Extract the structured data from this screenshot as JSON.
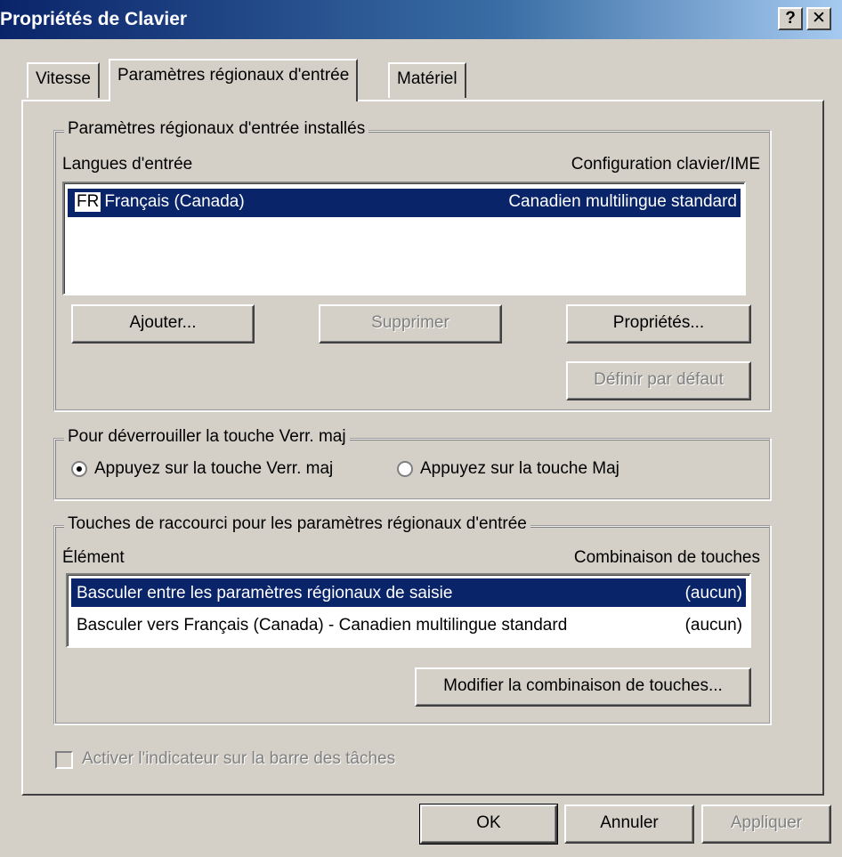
{
  "window": {
    "title": "Propriétés de Clavier",
    "help_label": "?",
    "close_label": "✕"
  },
  "tabs": [
    {
      "label": "Vitesse",
      "selected": false
    },
    {
      "label": "Paramètres régionaux d'entrée",
      "selected": true
    },
    {
      "label": "Matériel",
      "selected": false
    }
  ],
  "installed": {
    "group_label": "Paramètres régionaux d'entrée installés",
    "col_lang": "Langues d'entrée",
    "col_config": "Configuration clavier/IME",
    "rows": [
      {
        "badge": "FR",
        "lang": "Français (Canada)",
        "config": "Canadien multilingue standard",
        "selected": true
      }
    ],
    "buttons": {
      "add": "Ajouter...",
      "remove": "Supprimer",
      "properties": "Propriétés...",
      "set_default": "Définir par défaut"
    }
  },
  "capslock": {
    "group_label": "Pour déverrouiller la touche Verr. maj",
    "option_capslock": "Appuyez sur la touche Verr. maj",
    "option_shift": "Appuyez sur la touche Maj",
    "selected": "capslock"
  },
  "hotkeys": {
    "group_label": "Touches de raccourci pour les paramètres régionaux d'entrée",
    "col_item": "Élément",
    "col_keys": "Combinaison de touches",
    "rows": [
      {
        "item": "Basculer entre les paramètres régionaux de saisie",
        "keys": "(aucun)",
        "selected": true
      },
      {
        "item": "Basculer vers Français (Canada) - Canadien multilingue standard",
        "keys": "(aucun)",
        "selected": false
      }
    ],
    "modify_button": "Modifier la combinaison de touches..."
  },
  "taskbar_indicator": {
    "label": "Activer l'indicateur sur la barre des tâches",
    "checked": false,
    "enabled": false
  },
  "footer": {
    "ok": "OK",
    "cancel": "Annuler",
    "apply": "Appliquer"
  }
}
